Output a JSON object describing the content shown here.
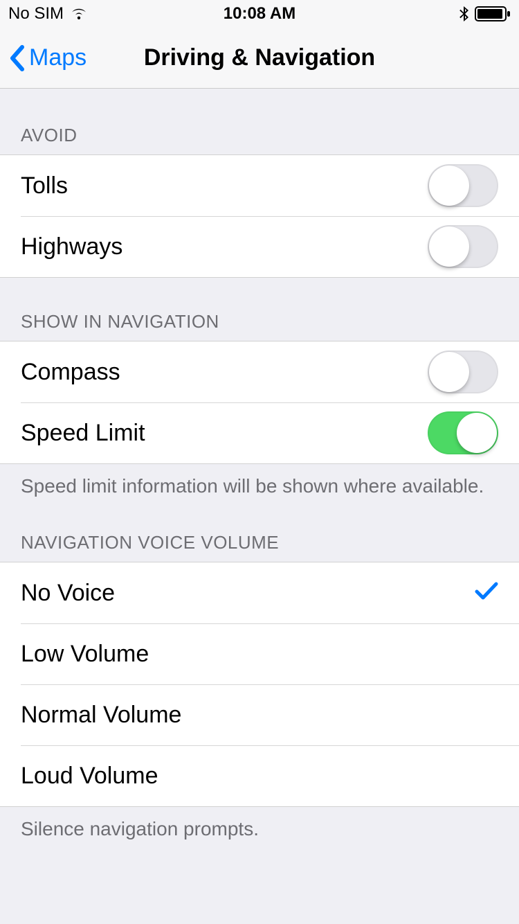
{
  "status_bar": {
    "carrier": "No SIM",
    "time": "10:08 AM"
  },
  "nav": {
    "back_label": "Maps",
    "title": "Driving & Navigation"
  },
  "sections": {
    "avoid": {
      "header": "AVOID",
      "tolls_label": "Tolls",
      "tolls_on": false,
      "highways_label": "Highways",
      "highways_on": false
    },
    "show": {
      "header": "SHOW IN NAVIGATION",
      "compass_label": "Compass",
      "compass_on": false,
      "speed_label": "Speed Limit",
      "speed_on": true,
      "footer": "Speed limit information will be shown where available."
    },
    "voice": {
      "header": "NAVIGATION VOICE VOLUME",
      "options": {
        "none": "No Voice",
        "low": "Low Volume",
        "normal": "Normal Volume",
        "loud": "Loud Volume"
      },
      "selected": "none",
      "footer": "Silence navigation prompts."
    }
  }
}
